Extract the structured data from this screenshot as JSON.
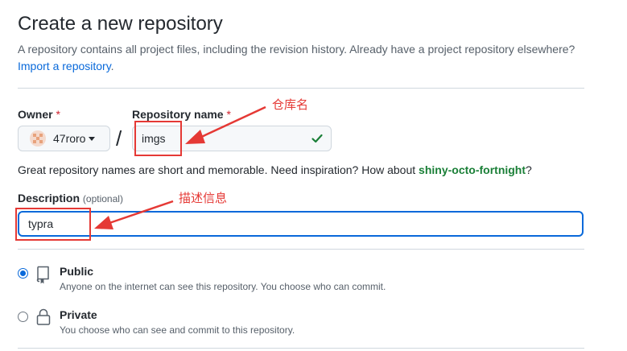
{
  "header": {
    "title": "Create a new repository",
    "subtitle": "A repository contains all project files, including the revision history. Already have a project repository elsewhere?",
    "import_link": "Import a repository",
    "import_period": "."
  },
  "owner": {
    "label": "Owner",
    "required_mark": "*",
    "value": "47roro"
  },
  "repo_name": {
    "label": "Repository name",
    "required_mark": "*",
    "value": "imgs",
    "separator": "/"
  },
  "hint": {
    "text": "Great repository names are short and memorable. Need inspiration? How about ",
    "suggestion": "shiny-octo-fortnight",
    "end": "?"
  },
  "description": {
    "label": "Description",
    "optional": "(optional)",
    "value": "typra"
  },
  "visibility": {
    "public": {
      "title": "Public",
      "desc": "Anyone on the internet can see this repository. You choose who can commit.",
      "selected": true
    },
    "private": {
      "title": "Private",
      "desc": "You choose who can see and commit to this repository.",
      "selected": false
    }
  },
  "annotations": {
    "repo_name_note": "仓库名",
    "description_note": "描述信息",
    "color": "#e53935"
  },
  "colors": {
    "link": "#0969da",
    "success": "#1a7f37",
    "danger": "#cf222e"
  }
}
